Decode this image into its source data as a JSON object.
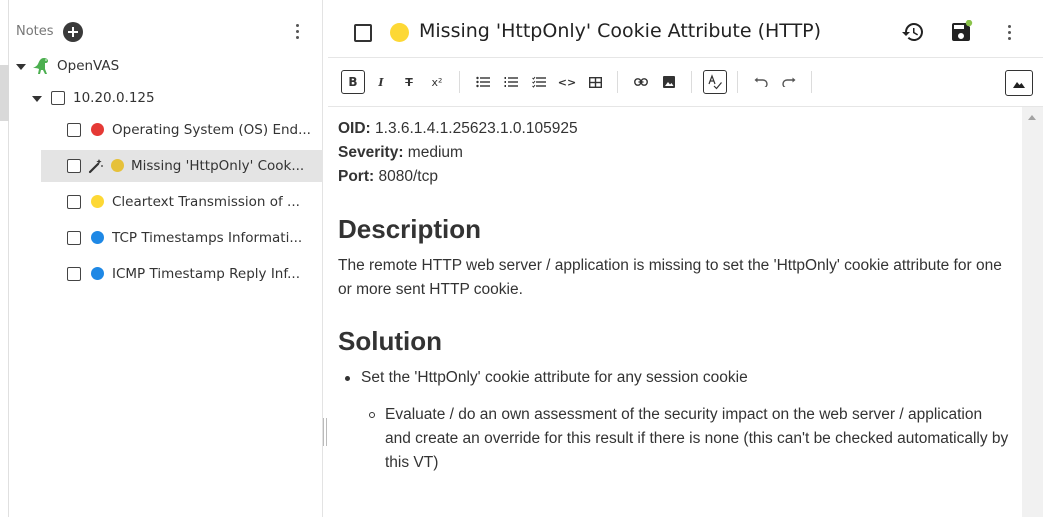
{
  "sidebar": {
    "title": "Notes",
    "tree": {
      "root": {
        "label": "OpenVAS",
        "icon": "dinosaur-icon"
      },
      "host": {
        "label": "10.20.0.125"
      },
      "items": [
        {
          "label": "Operating System (OS) End...",
          "color": "#e53935"
        },
        {
          "label": "Missing 'HttpOnly' Cook...",
          "color": "#e6c13a",
          "selected": true
        },
        {
          "label": "Cleartext Transmission of ...",
          "color": "#fdd835"
        },
        {
          "label": "TCP Timestamps Informati...",
          "color": "#1e88e5"
        },
        {
          "label": "ICMP Timestamp Reply Inf...",
          "color": "#1e88e5"
        }
      ]
    }
  },
  "header": {
    "title": "Missing 'HttpOnly' Cookie Attribute (HTTP)",
    "severity_color": "#fdd835"
  },
  "toolbar": {
    "bold": "B",
    "italic": "I",
    "strike": "T",
    "superscript": "x²",
    "code": "<>"
  },
  "content": {
    "meta": [
      {
        "key": "OID:",
        "value": "1.3.6.1.4.1.25623.1.0.105925"
      },
      {
        "key": "Severity:",
        "value": "medium"
      },
      {
        "key": "Port:",
        "value": "8080/tcp"
      }
    ],
    "description_heading": "Description",
    "description_text": "The remote HTTP web server / application is missing to set the 'HttpOnly' cookie attribute for one or more sent HTTP cookie.",
    "solution_heading": "Solution",
    "solution_bullet": "Set the 'HttpOnly' cookie attribute for any session cookie",
    "solution_sub_bullet": "Evaluate / do an own assessment of the security impact on the web server / application and create an override for this result if there is none (this can't be checked automatically by this VT)"
  }
}
